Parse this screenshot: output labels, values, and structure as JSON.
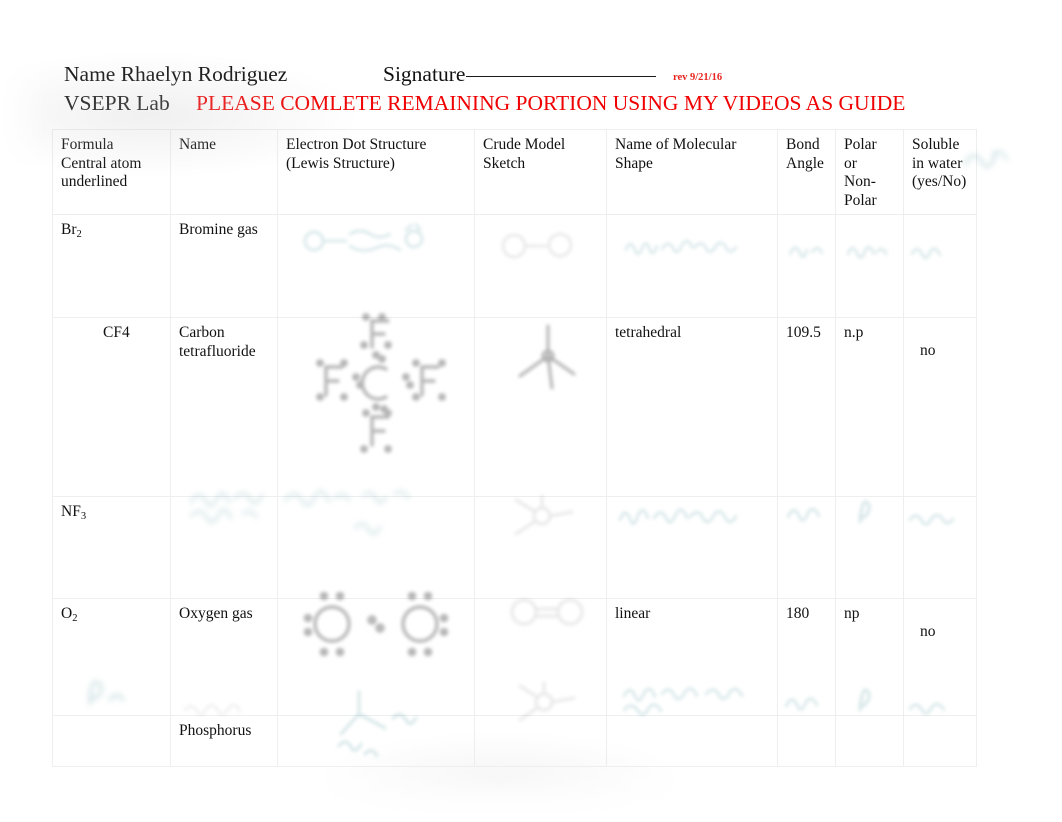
{
  "header": {
    "name_label": "Name Rhaelyn Rodriguez",
    "signature_label": "Signature",
    "revision": "rev 9/21/16",
    "lab_title": "VSEPR Lab",
    "instruction": "PLEASE COMLETE REMAINING PORTION USING MY VIDEOS AS GUIDE",
    "instruction_color": "#f00000"
  },
  "table": {
    "columns": [
      {
        "key": "formula",
        "label": "Formula Central atom underlined",
        "lines": [
          "Formula",
          "Central atom",
          "underlined"
        ]
      },
      {
        "key": "name",
        "label": "Name",
        "lines": [
          "Name"
        ]
      },
      {
        "key": "lewis",
        "label": "Electron Dot Structure (Lewis Structure)",
        "lines": [
          "Electron Dot Structure",
          "(Lewis Structure)"
        ]
      },
      {
        "key": "sketch",
        "label": "Crude Model Sketch",
        "lines": [
          "Crude Model",
          "Sketch"
        ]
      },
      {
        "key": "shape",
        "label": "Name of Molecular Shape",
        "lines": [
          "Name of Molecular",
          "Shape"
        ]
      },
      {
        "key": "angle",
        "label": "Bond Angle",
        "lines": [
          "Bond",
          "Angle"
        ]
      },
      {
        "key": "polar",
        "label": "Polar or Non-Polar",
        "lines": [
          "Polar",
          "or",
          "Non-",
          "Polar"
        ]
      },
      {
        "key": "soluble",
        "label": "Soluble in water (yes/No)",
        "lines": [
          "Soluble",
          "in water",
          "(yes/No)"
        ]
      }
    ],
    "rows": [
      {
        "id": "br2",
        "formula": "Br",
        "formula_sub": "2",
        "name": "Bromine gas",
        "lewis": "",
        "sketch": "",
        "shape": "",
        "angle": "",
        "polar": "",
        "soluble": "",
        "handwritten": true
      },
      {
        "id": "cf4",
        "formula": "CF4",
        "formula_sub": "",
        "name": "Carbon tetrafluoride",
        "lewis": "",
        "sketch": "",
        "shape": "tetrahedral",
        "angle": "109.5",
        "polar": "n.p",
        "soluble": "no",
        "handwritten": false
      },
      {
        "id": "nf3",
        "formula": "NF",
        "formula_sub": "3",
        "name": "",
        "lewis": "",
        "sketch": "",
        "shape": "",
        "angle": "",
        "polar": "",
        "soluble": "",
        "handwritten": true
      },
      {
        "id": "o2",
        "formula": "O",
        "formula_sub": "2",
        "name": "Oxygen gas",
        "lewis": "",
        "sketch": "",
        "shape": "linear",
        "angle": "180",
        "polar": "np",
        "soluble": "no",
        "handwritten": false
      },
      {
        "id": "p",
        "formula": "",
        "formula_sub": "",
        "name": "Phosphorus",
        "lewis": "",
        "sketch": "",
        "shape": "",
        "angle": "",
        "polar": "",
        "soluble": "",
        "handwritten": true
      }
    ]
  }
}
